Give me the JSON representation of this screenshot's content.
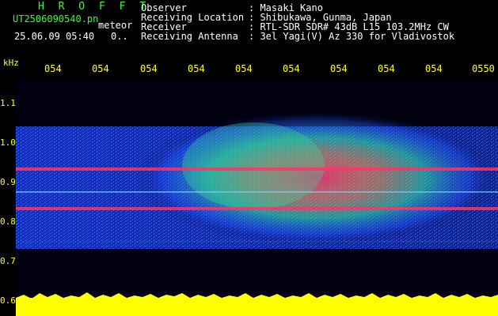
{
  "header": {
    "title": "H R O F F T",
    "filename": "UT2506090540.pn",
    "extension": "meteor",
    "datetime": "25.06.09 05:40",
    "dots": "0..",
    "fields": [
      {
        "label": "Observer",
        "value": ": Masaki Kano"
      },
      {
        "label": "Receiving Location",
        "value": ": Shibukawa, Gunma, Japan"
      },
      {
        "label": "Receiver",
        "value": ": RTL-SDR SDR# 43dB L15 103.2MHz CW"
      },
      {
        "label": "Receiving Antenna",
        "value": ": 3el Yagi(V) Az 330 for Vladivostok"
      }
    ]
  },
  "axis": {
    "y_unit": "kHz",
    "x_ticks": [
      "054",
      "054",
      "054",
      "054",
      "054",
      "054",
      "054",
      "054",
      "054",
      "0550"
    ],
    "y_ticks": [
      "1.1",
      "1.0",
      "0.9",
      "0.8",
      "0.7",
      "0.6"
    ]
  },
  "colors": {
    "background": "#000000",
    "header_green": "#33ff33",
    "header_white": "#ffffff",
    "tick_yellow": "#ffff33",
    "signal_red": "#ff3366",
    "noise_blue": "#1e3cff",
    "noise_green": "#33dd99"
  }
}
